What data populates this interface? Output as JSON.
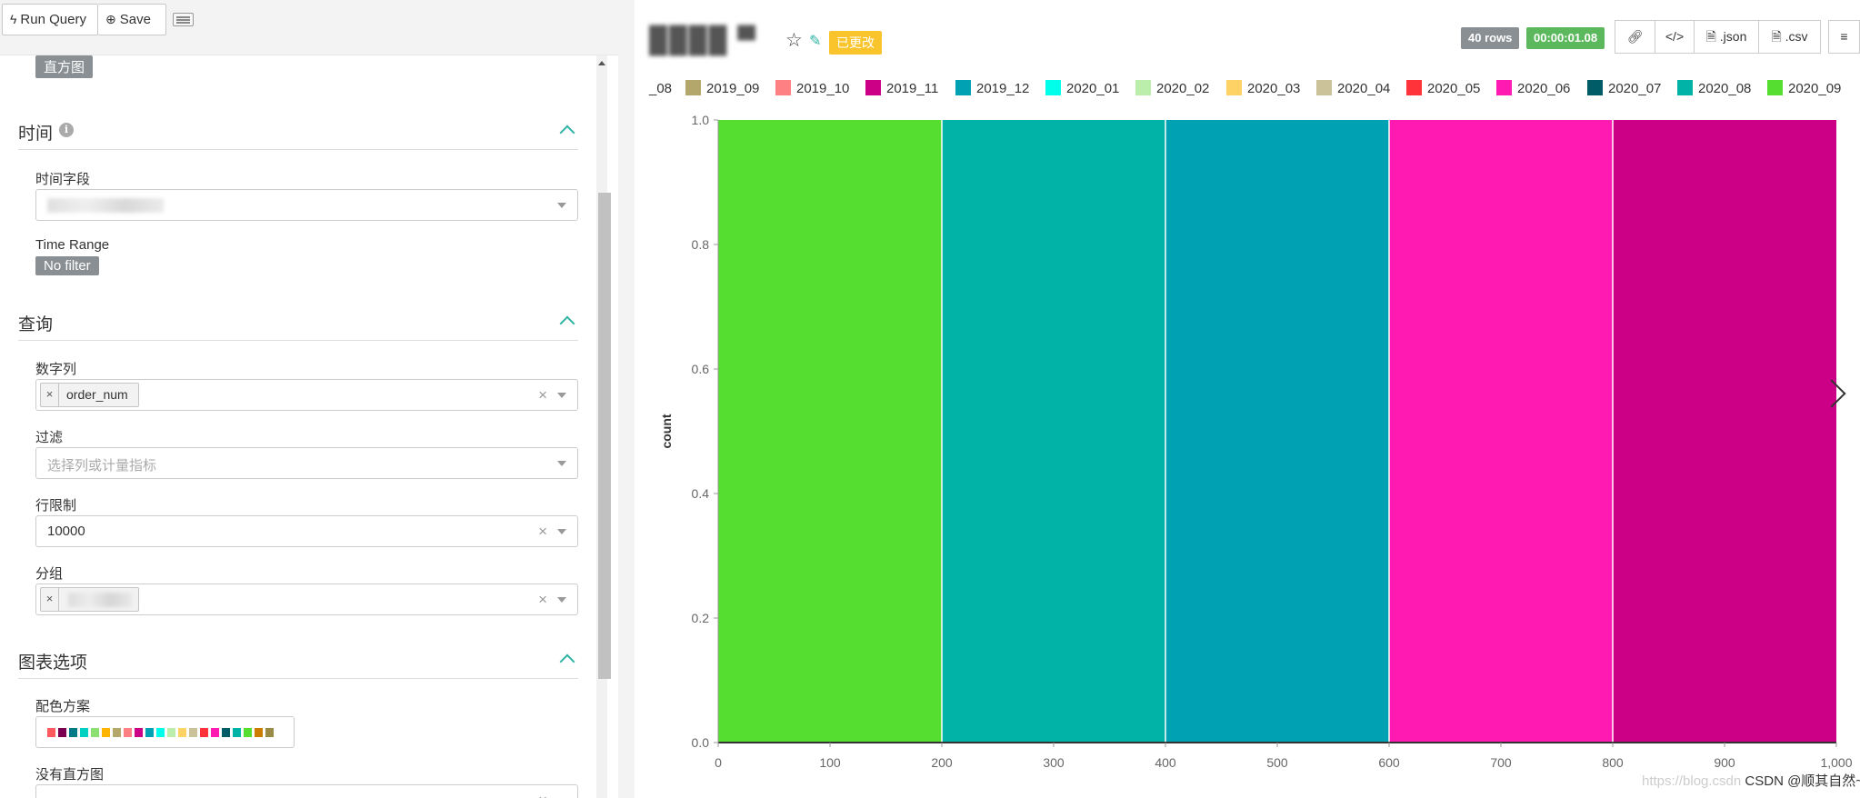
{
  "toolbar": {
    "run_query_label": "Run Query",
    "save_label": "Save"
  },
  "viz_badge": "直方图",
  "sections": {
    "time": {
      "title": "时间",
      "time_field_label": "时间字段",
      "time_range_label": "Time Range",
      "time_range_value": "No filter"
    },
    "query": {
      "title": "查询",
      "numeric_cols_label": "数字列",
      "numeric_cols_tag": "order_num",
      "filter_label": "过滤",
      "filter_placeholder": "选择列或计量指标",
      "row_limit_label": "行限制",
      "row_limit_value": "10000",
      "groupby_label": "分组"
    },
    "chart_options": {
      "title": "图表选项",
      "color_scheme_label": "配色方案",
      "color_scheme_swatches": [
        "#ff5a5f",
        "#7b0051",
        "#007a87",
        "#00d1c1",
        "#8ce071",
        "#ffb400",
        "#b4a76c",
        "#ff8083",
        "#cc0086",
        "#00a1b3",
        "#00ffeb",
        "#bbedab",
        "#ffd266",
        "#cbc29a",
        "#ff3339",
        "#ff1ab1",
        "#005c66",
        "#00b3a6",
        "#55dd30",
        "#cc7d00",
        "#998b46"
      ],
      "no_hist_label": "没有直方图"
    }
  },
  "header": {
    "changed_badge": "已更改",
    "rows_badge": "40 rows",
    "time_badge": "00:00:01.08",
    "json_label": ".json",
    "csv_label": ".csv"
  },
  "legend": [
    {
      "name": "_08",
      "color": ""
    },
    {
      "name": "2019_09",
      "color": "#b4a76c"
    },
    {
      "name": "2019_10",
      "color": "#ff8083"
    },
    {
      "name": "2019_11",
      "color": "#cc0086"
    },
    {
      "name": "2019_12",
      "color": "#00a1b3"
    },
    {
      "name": "2020_01",
      "color": "#00ffeb"
    },
    {
      "name": "2020_02",
      "color": "#bbedab"
    },
    {
      "name": "2020_03",
      "color": "#ffd266"
    },
    {
      "name": "2020_04",
      "color": "#cbc29a"
    },
    {
      "name": "2020_05",
      "color": "#ff3339"
    },
    {
      "name": "2020_06",
      "color": "#ff1ab1"
    },
    {
      "name": "2020_07",
      "color": "#005c66"
    },
    {
      "name": "2020_08",
      "color": "#00b3a6"
    },
    {
      "name": "2020_09",
      "color": "#55dd30"
    }
  ],
  "watermark": {
    "ghost": "https://blog.csdn",
    "text": "CSDN @顺其自然~"
  },
  "chart_data": {
    "type": "bar",
    "ylabel": "count",
    "xlim": [
      0,
      1000
    ],
    "ylim": [
      0,
      1.0
    ],
    "x_ticks": [
      "0",
      "100",
      "200",
      "300",
      "400",
      "500",
      "600",
      "700",
      "800",
      "900",
      "1,000"
    ],
    "y_ticks": [
      "0.0",
      "0.2",
      "0.4",
      "0.6",
      "0.8",
      "1.0"
    ],
    "bins": [
      {
        "x0": 0,
        "x1": 200,
        "value": 1.0,
        "color": "#55dd30"
      },
      {
        "x0": 200,
        "x1": 400,
        "value": 1.0,
        "color": "#00b3a6"
      },
      {
        "x0": 400,
        "x1": 600,
        "value": 1.0,
        "color": "#00a1b3"
      },
      {
        "x0": 600,
        "x1": 800,
        "value": 1.0,
        "color": "#ff1ab1"
      },
      {
        "x0": 800,
        "x1": 1000,
        "value": 1.0,
        "color": "#cc0086"
      }
    ]
  }
}
